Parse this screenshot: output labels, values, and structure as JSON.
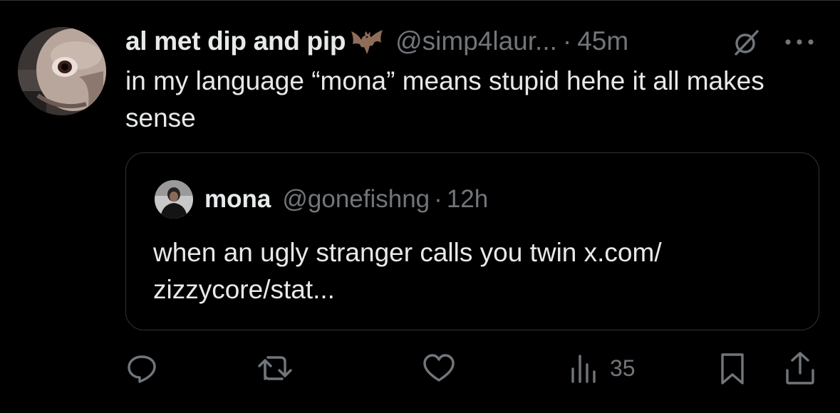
{
  "tweet": {
    "display_name": "al met dip and pip",
    "handle": "@simp4laur...",
    "separator": "·",
    "time": "45m",
    "text": "in my language “mona” means stupid hehe it all makes sense",
    "avatar_icon": "profile-photo",
    "emoji_icon": "bat-icon"
  },
  "quote": {
    "display_name": "mona",
    "handle": "@gonefishng",
    "separator": "·",
    "time": "12h",
    "text_line1": "when an ugly stranger calls you twin x.com/",
    "text_line2": "zizzycore/stat..."
  },
  "actions": {
    "views_count": "35",
    "icons": [
      "reply-icon",
      "retweet-icon",
      "like-icon",
      "views-icon",
      "bookmark-icon",
      "share-icon"
    ]
  },
  "colors": {
    "background": "#000000",
    "primary_text": "#e7e9ea",
    "secondary_text": "#71767b",
    "border": "#2f3336"
  }
}
